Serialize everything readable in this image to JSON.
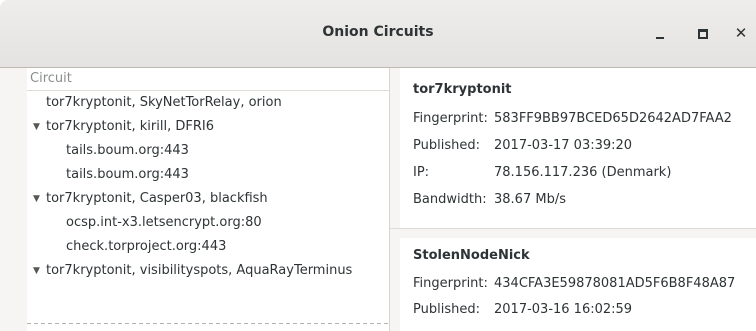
{
  "window": {
    "title": "Onion Circuits"
  },
  "circuit_list": {
    "column_header": "Circuit",
    "rows": [
      {
        "label": "tor7kryptonit, SkyNetTorRelay, orion",
        "level": 0,
        "expanded": false
      },
      {
        "label": "tor7kryptonit, kirill, DFRI6",
        "level": 0,
        "expanded": true
      },
      {
        "label": "tails.boum.org:443",
        "level": 1
      },
      {
        "label": "tails.boum.org:443",
        "level": 1
      },
      {
        "label": "tor7kryptonit, Casper03, blackfish",
        "level": 0,
        "expanded": true
      },
      {
        "label": "ocsp.int-x3.letsencrypt.org:80",
        "level": 1
      },
      {
        "label": "check.torproject.org:443",
        "level": 1
      },
      {
        "label": "tor7kryptonit, visibilityspots, AquaRayTerminus",
        "level": 0,
        "expanded": true
      }
    ]
  },
  "details": {
    "relay1": {
      "name": "tor7kryptonit",
      "fingerprint_label": "Fingerprint:",
      "fingerprint": "583FF9BB97BCED65D2642AD7FAA2",
      "published_label": "Published:",
      "published": "2017-03-17 03:39:20",
      "ip_label": "IP:",
      "ip": "78.156.117.236 (Denmark)",
      "bandwidth_label": "Bandwidth:",
      "bandwidth": "38.67 Mb/s"
    },
    "relay2": {
      "name": "StolenNodeNick",
      "fingerprint_label": "Fingerprint:",
      "fingerprint": "434CFA3E59878081AD5F6B8F48A87",
      "published_label": "Published:",
      "published": "2017-03-16 16:02:59"
    }
  },
  "icons": {
    "expand": "triangle-down-icon",
    "minimize": "minimize-icon",
    "maximize": "maximize-icon",
    "close": "close-icon"
  }
}
